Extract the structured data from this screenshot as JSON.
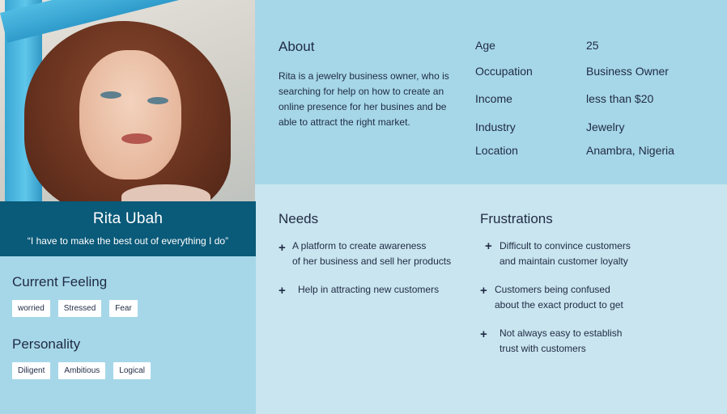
{
  "persona": {
    "name": "Rita Ubah",
    "quote": "“I have to make the best out of everything I do”"
  },
  "current_feeling": {
    "title": "Current Feeling",
    "tags": [
      "worried",
      "Stressed",
      "Fear"
    ]
  },
  "personality": {
    "title": "Personality",
    "tags": [
      "Diligent",
      "Ambitious",
      "Logical"
    ]
  },
  "about": {
    "title": "About",
    "text": "Rita is a jewelry business owner, who is searching for help on how to create an online presence for her busines and be able to attract the right market."
  },
  "attributes": [
    {
      "label": "Age",
      "value": "25"
    },
    {
      "label": "Occupation",
      "value": "Business Owner"
    },
    {
      "label": "Income",
      "value": "less than $20"
    },
    {
      "label": "Industry",
      "value": "Jewelry"
    },
    {
      "label": "Location",
      "value": "Anambra, Nigeria"
    }
  ],
  "needs": {
    "title": "Needs",
    "items": [
      [
        "A platform to create awareness",
        "of her business and sell her products"
      ],
      [
        "Help in attracting new customers"
      ]
    ]
  },
  "frustrations": {
    "title": "Frustrations",
    "items": [
      [
        "Difficult to convince customers",
        "and  maintain customer loyalty"
      ],
      [
        "Customers being confused",
        "about the exact product to get"
      ],
      [
        "Not always easy to establish",
        "trust with customers"
      ]
    ]
  },
  "icons": {
    "bullet": "plus-icon"
  },
  "colors": {
    "banner": "#0a5a79",
    "panel_dark": "#a6d7e8",
    "panel_light": "#c9e5ef",
    "text": "#1f2a44"
  }
}
